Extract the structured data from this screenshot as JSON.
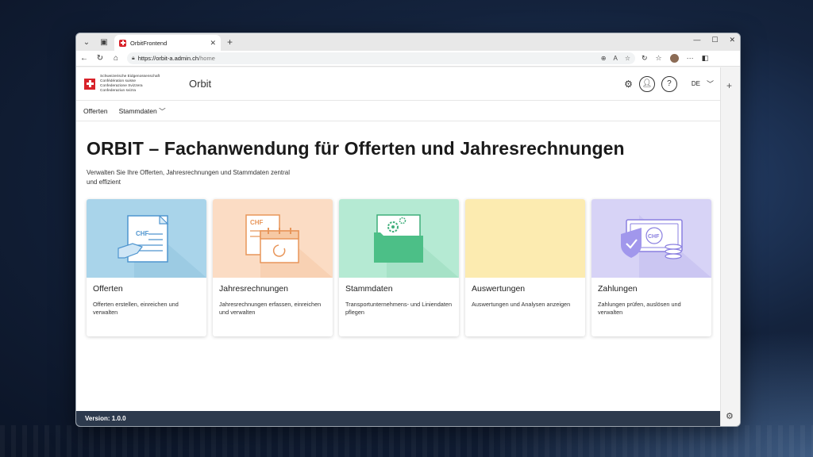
{
  "browser": {
    "tab_title": "OrbitFrontend",
    "url_host": "https://orbit-a.admin.ch",
    "url_path": "/home"
  },
  "header": {
    "confederation_lines": [
      "Schweizerische Eidgenossenschaft",
      "Confédération suisse",
      "Confederazione Svizzera",
      "Confederaziun svizra"
    ],
    "app_name": "Orbit",
    "language": "DE"
  },
  "nav": {
    "items": [
      "Offerten",
      "Stammdaten"
    ]
  },
  "main": {
    "title": "ORBIT – Fachanwendung für Offerten und Jahresrechnungen",
    "subtitle": "Verwalten Sie Ihre Offerten, Jahresrechnungen und Stammdaten zentral und effizient",
    "cards": [
      {
        "title": "Offerten",
        "description": "Offerten erstellen, einreichen und verwalten",
        "color": "#a9d4ea",
        "icon_text": "CHF"
      },
      {
        "title": "Jahresrechnungen",
        "description": "Jahresrechnungen erfassen, einreichen und verwalten",
        "color": "#fbdcc4",
        "icon_text": "CHF"
      },
      {
        "title": "Stammdaten",
        "description": "Transportunternehmens- und Liniendaten pflegen",
        "color": "#b5ead3"
      },
      {
        "title": "Auswertungen",
        "description": "Auswertungen und Analysen anzeigen",
        "color": "#fcebb0"
      },
      {
        "title": "Zahlungen",
        "description": "Zahlungen prüfen, auslösen und verwalten",
        "color": "#d7d3f6",
        "icon_text": "CHF"
      }
    ]
  },
  "footer": {
    "version": "Version: 1.0.0"
  }
}
